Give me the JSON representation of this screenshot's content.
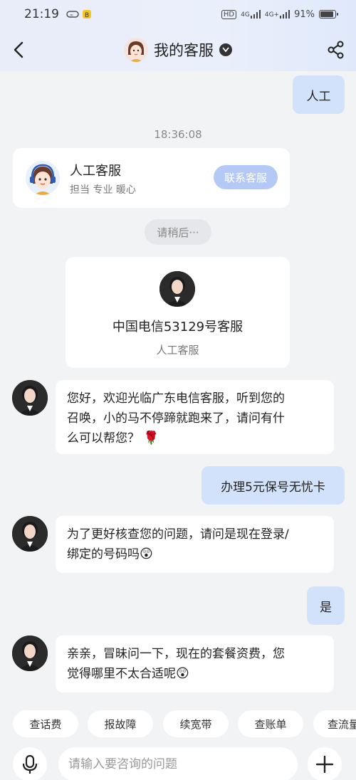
{
  "status_bar": {
    "time": "21:19",
    "battery": "91%",
    "battery_level": 0.91,
    "network_labels": [
      "HD",
      "4G",
      "4G+"
    ]
  },
  "header": {
    "title": "我的客服"
  },
  "chat": {
    "msg_user_1": "人工",
    "timestamp": "18:36:08",
    "service_card": {
      "title": "人工客服",
      "tags": "担当 专业 暖心",
      "button": "联系客服"
    },
    "waiting": "请稍后···",
    "agent_card": {
      "name": "中国电信53129号客服",
      "role": "人工客服"
    },
    "msg_agent_1_line1": "您好，欢迎光临广东电信客服，听到您的",
    "msg_agent_1_line2": "召唤，小的马不停蹄就跑来了，请问有什",
    "msg_agent_1_line3": "么可以帮您？",
    "msg_agent_1_emoji": "🌹",
    "msg_user_2": "办理5元保号无忧卡",
    "msg_agent_2_line1": "为了更好核查您的问题，请问是现在登录/",
    "msg_agent_2_line2": "绑定的号码吗",
    "msg_agent_2_emoji": "😲",
    "msg_user_3": "是",
    "msg_agent_3_line1": "亲亲，冒昧问一下，现在的套餐资费，您",
    "msg_agent_3_line2": "觉得哪里不太合适呢",
    "msg_agent_3_emoji": "😲"
  },
  "quick_replies": [
    "查话费",
    "报故障",
    "续宽带",
    "查账单",
    "查流量"
  ],
  "input": {
    "placeholder": "请输入要咨询的问题"
  }
}
